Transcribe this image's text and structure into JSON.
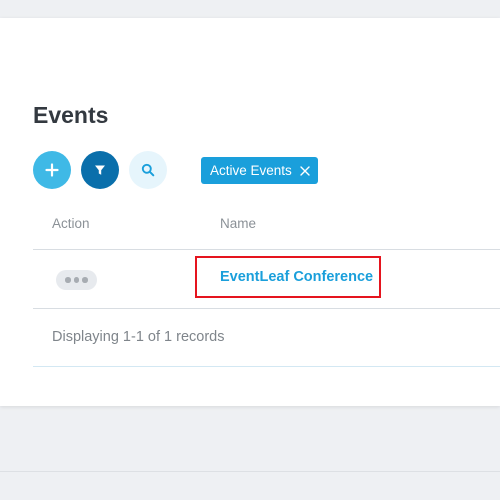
{
  "page": {
    "title": "Events"
  },
  "toolbar": {
    "add_icon": "plus-icon",
    "filter_icon": "filter-funnel-icon",
    "search_icon": "magnifier-icon"
  },
  "filter_chip": {
    "label": "Active Events",
    "close_icon": "close-x-icon"
  },
  "table": {
    "columns": [
      "Action",
      "Name"
    ],
    "rows": [
      {
        "action_icon": "ellipsis-icon",
        "name": "EventLeaf Conference"
      }
    ],
    "footer": "Displaying 1-1 of 1 records"
  },
  "colors": {
    "accent": "#1a9fdb",
    "primary_dark": "#0a6fab",
    "add_button": "#3fb9e6",
    "highlight_box": "#e5141e"
  }
}
